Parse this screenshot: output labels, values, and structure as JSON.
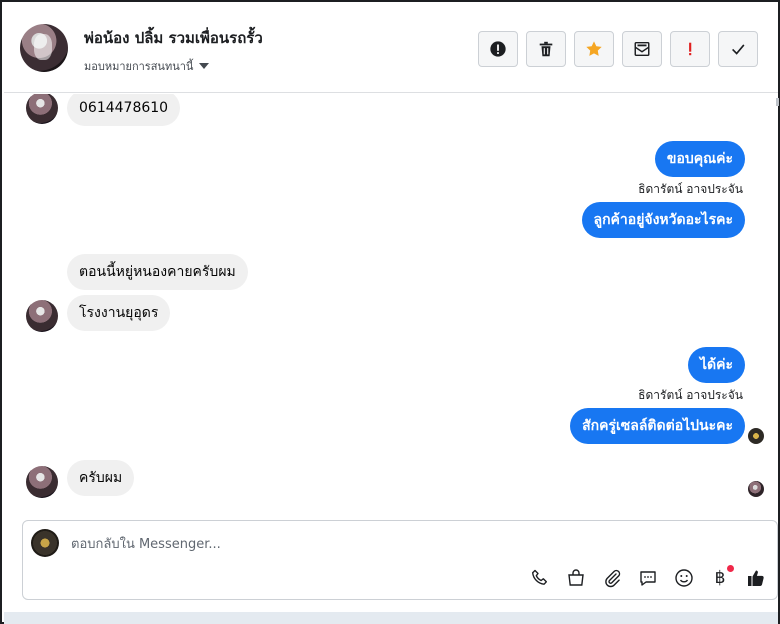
{
  "header": {
    "contact_name": "พ่อน้อง ปลิ้ม รวมเพื่อนรถรั้ว",
    "assign_label": "มอบหมายการสนทนานี้",
    "actions": [
      {
        "name": "spam-button",
        "icon": "exclamation-circle-icon"
      },
      {
        "name": "delete-button",
        "icon": "trash-icon"
      },
      {
        "name": "star-button",
        "icon": "star-icon"
      },
      {
        "name": "mark-unread-button",
        "icon": "envelope-icon"
      },
      {
        "name": "follow-up-button",
        "icon": "exclamation-icon"
      },
      {
        "name": "mark-done-button",
        "icon": "checkmark-icon"
      }
    ]
  },
  "messages": [
    {
      "side": "in",
      "text": "0614478610"
    },
    {
      "side": "out",
      "text": "ขอบคุณค่ะ"
    },
    {
      "side": "out",
      "sender": "ธิดารัตน์ อาจประจัน"
    },
    {
      "side": "out",
      "text": "ลูกค้าอยู่จังหวัดอะไรคะ"
    },
    {
      "side": "in",
      "text": "ตอนนี้หยู่หนองคายครับผม"
    },
    {
      "side": "in",
      "text": "โรงงานยุอุดร"
    },
    {
      "side": "out",
      "text": "ได้ค่ะ"
    },
    {
      "side": "out",
      "sender": "ธิดารัตน์ อาจประจัน"
    },
    {
      "side": "out",
      "text": "สักครู่เซลล์ติดต่อไปนะคะ"
    },
    {
      "side": "in",
      "text": "ครับผม"
    }
  ],
  "composer": {
    "placeholder": "ตอบกลับใน Messenger...",
    "tools": [
      "phone-icon",
      "shopping-bag-icon",
      "paperclip-icon",
      "saved-reply-icon",
      "emoji-icon",
      "baht-icon",
      "thumbs-up-icon"
    ],
    "baht_symbol": "฿"
  },
  "colors": {
    "outgoing_bubble": "#1877f2",
    "incoming_bubble": "#f0f0f0",
    "star": "#f5a623",
    "alert": "#e02020"
  }
}
